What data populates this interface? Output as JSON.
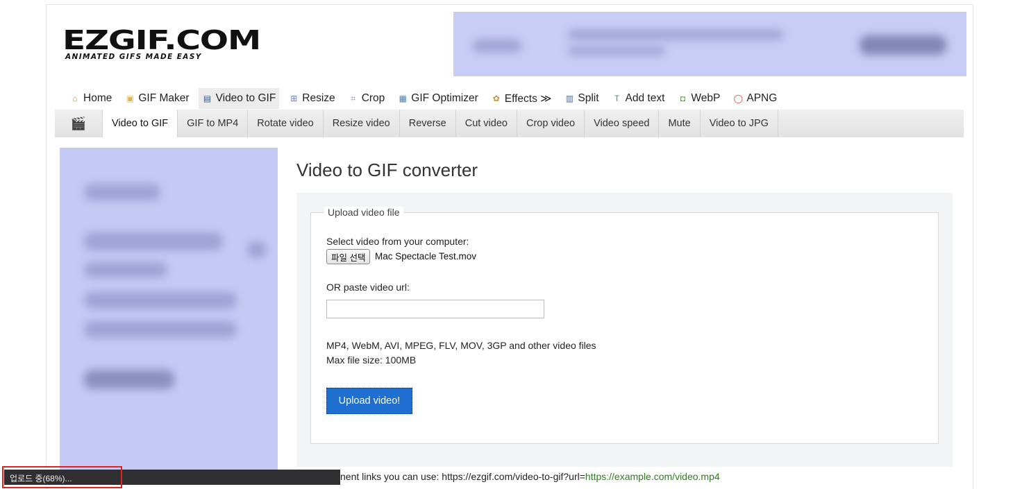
{
  "logo": {
    "main": "EZGIF.COM",
    "tagline": "ANIMATED GIFS MADE EASY"
  },
  "main_nav": [
    {
      "label": "Home",
      "icon": "home-icon",
      "color": "#d98c2b",
      "glyph": "⌂"
    },
    {
      "label": "GIF Maker",
      "icon": "gif-maker-icon",
      "color": "#e4b64a",
      "glyph": "▣"
    },
    {
      "label": "Video to GIF",
      "icon": "film-icon",
      "color": "#3a5a8c",
      "glyph": "▤",
      "active": true
    },
    {
      "label": "Resize",
      "icon": "resize-icon",
      "color": "#5b7fc4",
      "glyph": "⊞"
    },
    {
      "label": "Crop",
      "icon": "crop-icon",
      "color": "#7a8fb0",
      "glyph": "⌗"
    },
    {
      "label": "GIF Optimizer",
      "icon": "optimizer-icon",
      "color": "#4f7fb5",
      "glyph": "▦"
    },
    {
      "label": "Effects ≫",
      "icon": "effects-icon",
      "color": "#c98f3a",
      "glyph": "✿"
    },
    {
      "label": "Split",
      "icon": "split-icon",
      "color": "#4a6a9a",
      "glyph": "▥"
    },
    {
      "label": "Add text",
      "icon": "add-text-icon",
      "color": "#6b8a6b",
      "glyph": "T"
    },
    {
      "label": "WebP",
      "icon": "webp-icon",
      "color": "#5aa83a",
      "glyph": "◘"
    },
    {
      "label": "APNG",
      "icon": "apng-icon",
      "color": "#e0402a",
      "glyph": "◯"
    }
  ],
  "sub_nav": [
    {
      "label": "Video to GIF",
      "active": true
    },
    {
      "label": "GIF to MP4"
    },
    {
      "label": "Rotate video"
    },
    {
      "label": "Resize video"
    },
    {
      "label": "Reverse"
    },
    {
      "label": "Cut video"
    },
    {
      "label": "Crop video"
    },
    {
      "label": "Video speed"
    },
    {
      "label": "Mute"
    },
    {
      "label": "Video to JPG"
    }
  ],
  "page_title": "Video to GIF converter",
  "form": {
    "legend": "Upload video file",
    "select_label": "Select video from your computer:",
    "file_button": "파일 선택",
    "file_name": "Mac Spectacle Test.mov",
    "url_label": "OR paste video url:",
    "url_value": "",
    "formats": "MP4, WebM, AVI, MPEG, FLV, MOV, 3GP and other video files",
    "max_size": "Max file size: 100MB",
    "upload_button": "Upload video!"
  },
  "bottom": {
    "prefix": "nent links you can use: https://ezgif.com/video-to-gif?url=",
    "link": "https://example.com/video.mp4"
  },
  "status": {
    "text": "업로드 중(68%)...",
    "progress_percent": 68
  },
  "colors": {
    "upload_button": "#1f6fd1",
    "ad_placeholder": "#c6c9f4",
    "link_green": "#2d7d1e",
    "highlight_red": "#e0201a"
  }
}
